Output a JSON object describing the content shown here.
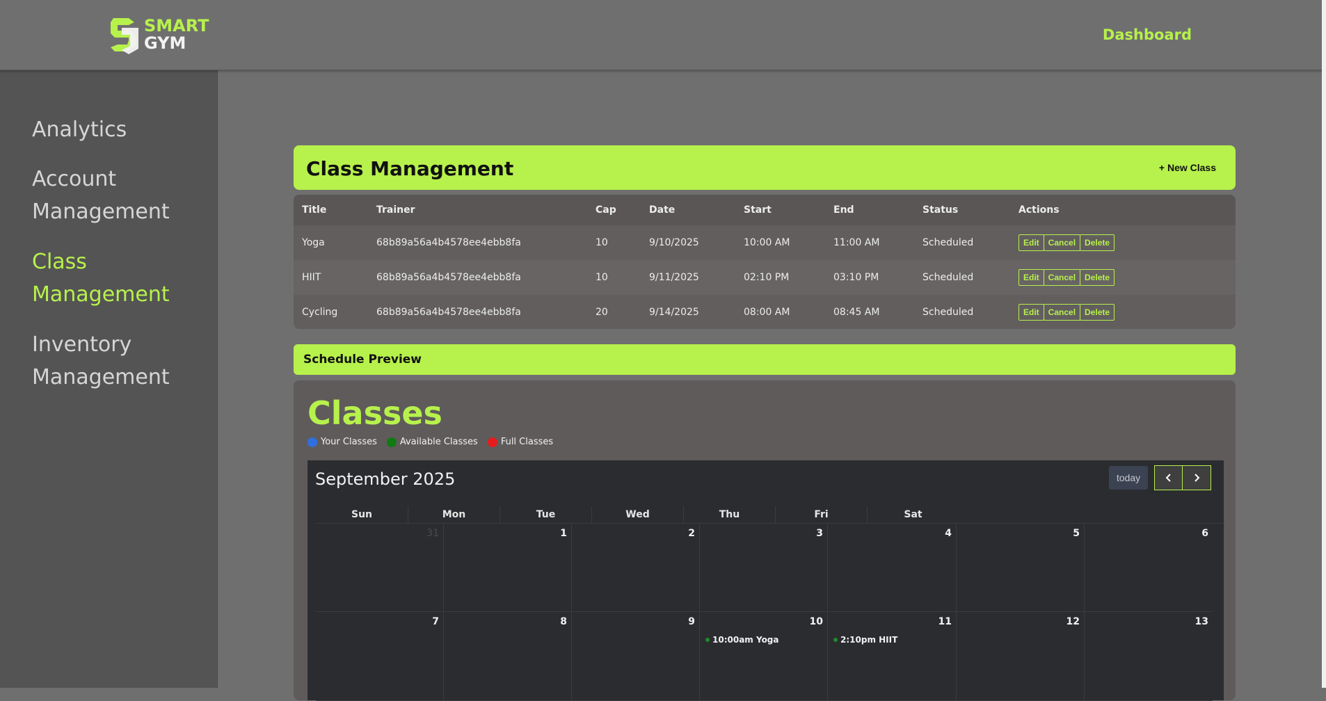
{
  "brand": {
    "line1": "SMART",
    "line2": "GYM",
    "accent": "#b7f14c"
  },
  "topnav": {
    "dashboard": "Dashboard"
  },
  "sidebar": {
    "items": [
      {
        "label": "Analytics",
        "active": false
      },
      {
        "label": "Account Management",
        "active": false
      },
      {
        "label": "Class Management",
        "active": true
      },
      {
        "label": "Inventory Management",
        "active": false
      }
    ]
  },
  "class_management": {
    "title": "Class Management",
    "new_class": "+ New Class",
    "columns": [
      "Title",
      "Trainer",
      "Cap",
      "Date",
      "Start",
      "End",
      "Status",
      "Actions"
    ],
    "rows": [
      {
        "title": "Yoga",
        "trainer": "68b89a56a4b4578ee4ebb8fa",
        "cap": "10",
        "date": "9/10/2025",
        "start": "10:00 AM",
        "end": "11:00 AM",
        "status": "Scheduled"
      },
      {
        "title": "HIIT",
        "trainer": "68b89a56a4b4578ee4ebb8fa",
        "cap": "10",
        "date": "9/11/2025",
        "start": "02:10 PM",
        "end": "03:10 PM",
        "status": "Scheduled"
      },
      {
        "title": "Cycling",
        "trainer": "68b89a56a4b4578ee4ebb8fa",
        "cap": "20",
        "date": "9/14/2025",
        "start": "08:00 AM",
        "end": "08:45 AM",
        "status": "Scheduled"
      }
    ],
    "actions": {
      "edit": "Edit",
      "cancel": "Cancel",
      "delete": "Delete"
    }
  },
  "schedule_preview": {
    "title": "Schedule Preview",
    "heading": "Classes",
    "legend": [
      {
        "label": "Your Classes",
        "color": "#2f6fe0"
      },
      {
        "label": "Available Classes",
        "color": "#127a12"
      },
      {
        "label": "Full Classes",
        "color": "#e51c1c"
      }
    ],
    "calendar": {
      "month": "September 2025",
      "today": "today",
      "days_of_week": [
        "Sun",
        "Mon",
        "Tue",
        "Wed",
        "Thu",
        "Fri",
        "Sat"
      ],
      "weeks": [
        [
          {
            "n": "31",
            "muted": true
          },
          {
            "n": "1"
          },
          {
            "n": "2"
          },
          {
            "n": "3"
          },
          {
            "n": "4"
          },
          {
            "n": "5"
          },
          {
            "n": "6"
          }
        ],
        [
          {
            "n": "7"
          },
          {
            "n": "8"
          },
          {
            "n": "9"
          },
          {
            "n": "10",
            "event": "10:00am Yoga"
          },
          {
            "n": "11",
            "event": "2:10pm HIIT"
          },
          {
            "n": "12"
          },
          {
            "n": "13"
          }
        ]
      ]
    }
  }
}
